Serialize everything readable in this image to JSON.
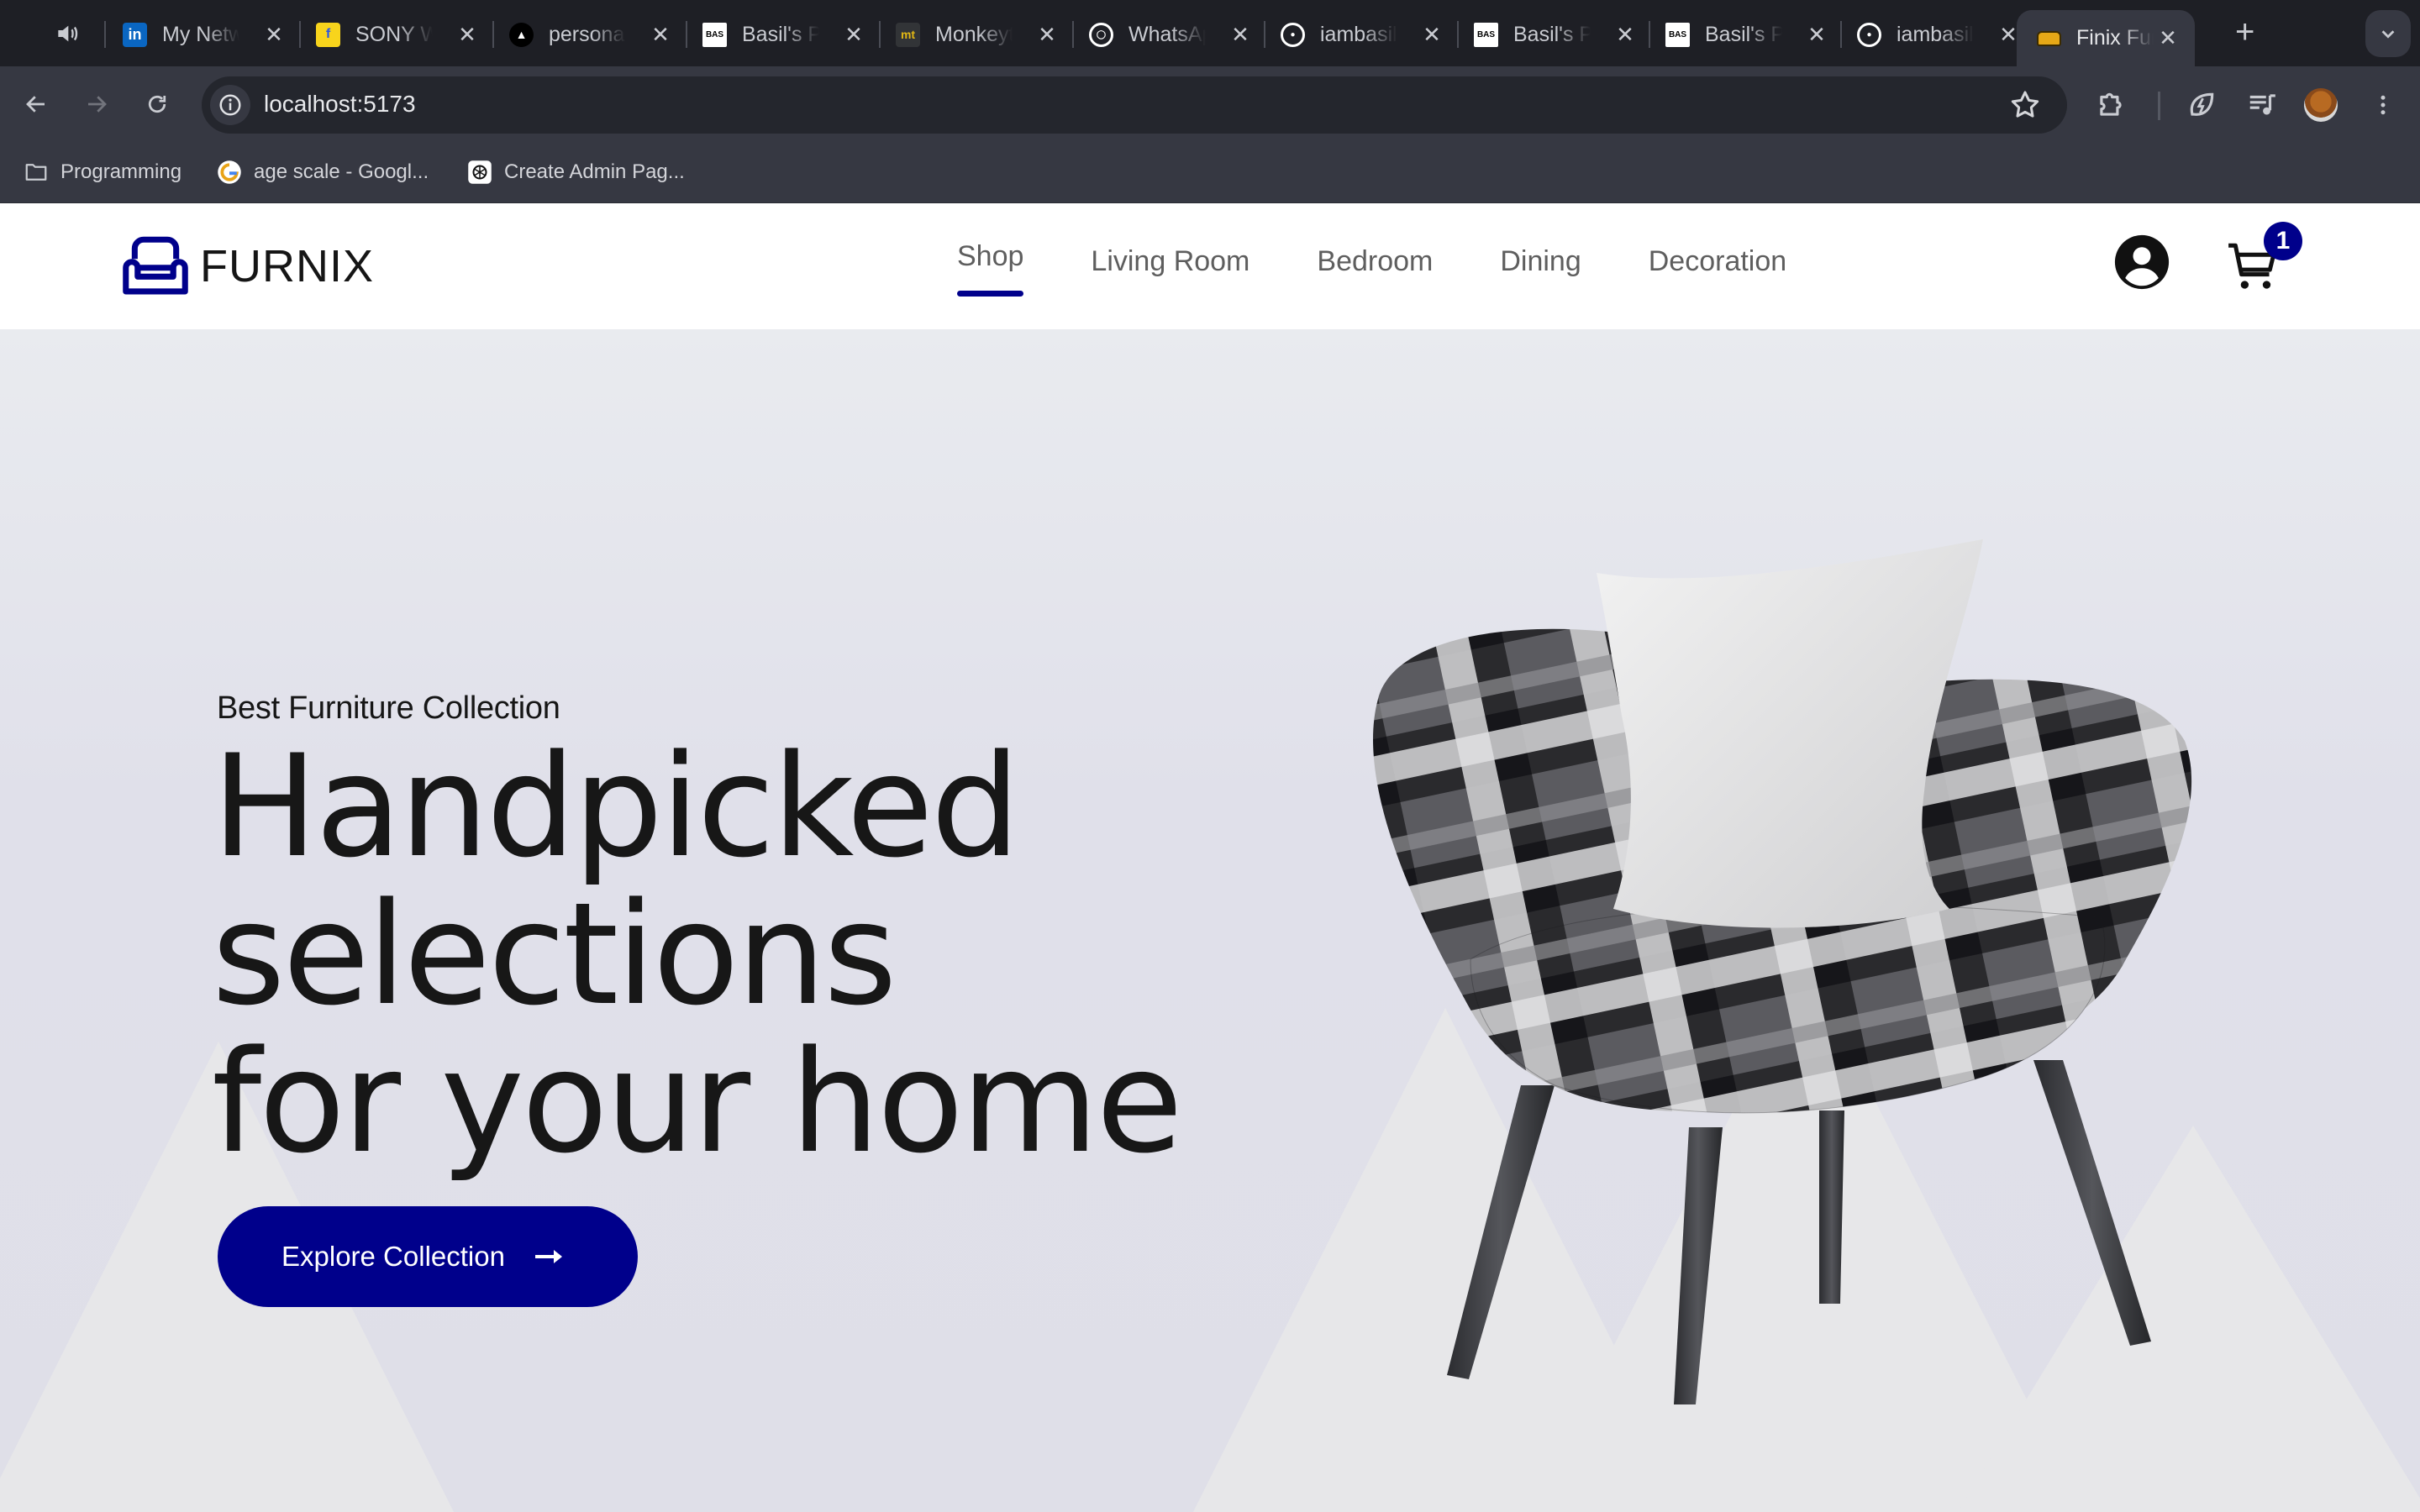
{
  "browser": {
    "tabs": [
      {
        "title": "My Network",
        "favicon": "linkedin-icon",
        "fav_color": "#0a66c2",
        "fav_text": "in"
      },
      {
        "title": "SONY W",
        "favicon": "flipkart-icon",
        "fav_color": "#f8d41c",
        "fav_text": "f"
      },
      {
        "title": "personal",
        "favicon": "vercel-icon",
        "fav_color": "#000000",
        "fav_text": "▲"
      },
      {
        "title": "Basil's P",
        "favicon": "bas-icon",
        "fav_color": "#ffffff",
        "fav_text": "BAS"
      },
      {
        "title": "Monkeytype",
        "favicon": "monkeytype-icon",
        "fav_color": "#323437",
        "fav_text": "mt"
      },
      {
        "title": "WhatsApp",
        "favicon": "whatsapp-icon",
        "fav_color": "#1e1f25",
        "fav_text": "◯"
      },
      {
        "title": "iambasil",
        "favicon": "github-icon",
        "fav_color": "#1e1f25",
        "fav_text": "●"
      },
      {
        "title": "Basil's P",
        "favicon": "bas-icon",
        "fav_color": "#ffffff",
        "fav_text": "BAS"
      },
      {
        "title": "Basil's P",
        "favicon": "bas-icon",
        "fav_color": "#ffffff",
        "fav_text": "BAS"
      },
      {
        "title": "iambasil",
        "favicon": "github-icon",
        "fav_color": "#1e1f25",
        "fav_text": "●"
      },
      {
        "title": "Finix Furniture",
        "favicon": "sofa-icon",
        "fav_color": "#e6a817",
        "fav_text": "",
        "active": true
      }
    ],
    "close_glyph": "✕",
    "new_tab_glyph": "+",
    "url": "localhost:5173",
    "bookmarks": [
      {
        "label": "Programming",
        "icon": "folder-icon"
      },
      {
        "label": "age scale - Googl...",
        "icon": "google-icon"
      },
      {
        "label": "Create Admin Pag...",
        "icon": "chatgpt-icon"
      }
    ]
  },
  "site": {
    "brand": "FURNIX",
    "nav": [
      {
        "label": "Shop",
        "active": true
      },
      {
        "label": "Living Room"
      },
      {
        "label": "Bedroom"
      },
      {
        "label": "Dining"
      },
      {
        "label": "Decoration"
      }
    ],
    "cart_count": "1",
    "accent_color": "#00008b"
  },
  "hero": {
    "eyebrow": "Best Furniture Collection",
    "headline_lines": [
      "Handpicked",
      "selections",
      "for your home"
    ],
    "cta_label": "Explore Collection",
    "cta_arrow": "⟶",
    "image": "patterned-armchair-with-pillow"
  }
}
